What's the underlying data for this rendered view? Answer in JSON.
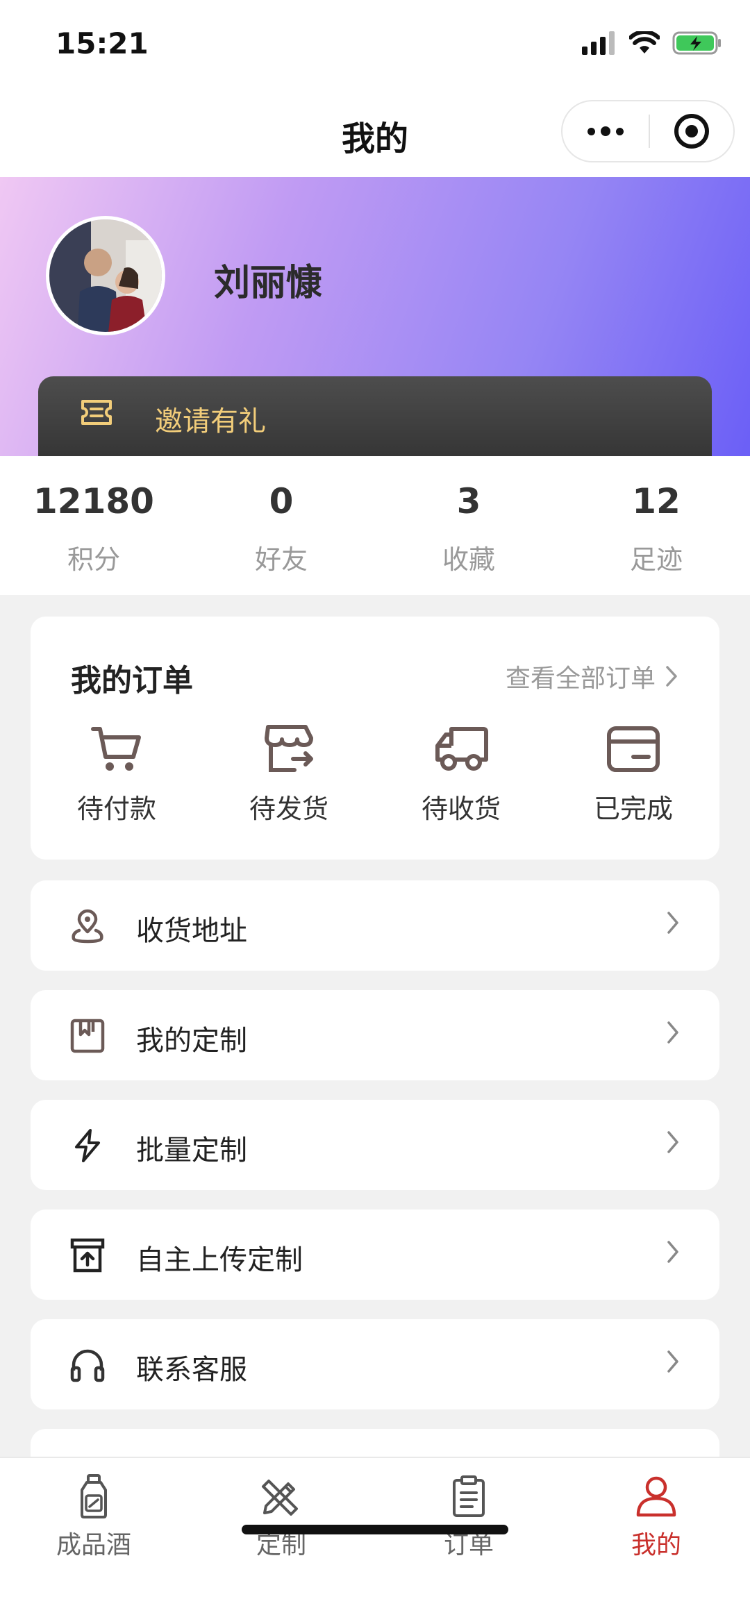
{
  "status_bar": {
    "time": "15:21"
  },
  "nav": {
    "title": "我的"
  },
  "profile": {
    "username": "刘丽慷",
    "invite_label": "邀请有礼",
    "gradient": [
      "#f0c8f3",
      "#6b5ff6"
    ]
  },
  "stats": [
    {
      "value": "12180",
      "label": "积分"
    },
    {
      "value": "0",
      "label": "好友"
    },
    {
      "value": "3",
      "label": "收藏"
    },
    {
      "value": "12",
      "label": "足迹"
    }
  ],
  "orders": {
    "title": "我的订单",
    "view_all": "查看全部订单",
    "items": [
      {
        "label": "待付款",
        "icon": "cart-icon"
      },
      {
        "label": "待发货",
        "icon": "shop-ship-icon"
      },
      {
        "label": "待收货",
        "icon": "truck-icon"
      },
      {
        "label": "已完成",
        "icon": "wallet-icon"
      }
    ]
  },
  "menu": [
    {
      "label": "收货地址",
      "icon": "location-pin-icon"
    },
    {
      "label": "我的定制",
      "icon": "custom-box-icon"
    },
    {
      "label": "批量定制",
      "icon": "lightning-icon"
    },
    {
      "label": "自主上传定制",
      "icon": "upload-box-icon"
    },
    {
      "label": "联系客服",
      "icon": "headset-icon"
    }
  ],
  "tabbar": {
    "active_color": "#c9302c",
    "items": [
      {
        "label": "成品酒",
        "icon": "bottle-icon",
        "active": false
      },
      {
        "label": "定制",
        "icon": "pencil-ruler-icon",
        "active": false
      },
      {
        "label": "订单",
        "icon": "clipboard-icon",
        "active": false
      },
      {
        "label": "我的",
        "icon": "user-icon",
        "active": true
      }
    ]
  }
}
